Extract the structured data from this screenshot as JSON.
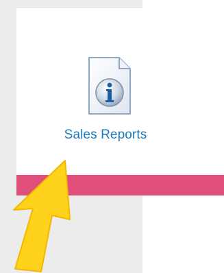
{
  "tile": {
    "label": "Sales Reports",
    "icon": "info-document-icon"
  },
  "overlay": {
    "pointer_icon": "arrow-cursor-icon"
  },
  "colors": {
    "label": "#1a7ab8",
    "accent_bar": "#e04e7a",
    "panel_gray": "#ececec",
    "pointer_fill": "#ffd21c",
    "info_blue": "#1a5fa6"
  }
}
